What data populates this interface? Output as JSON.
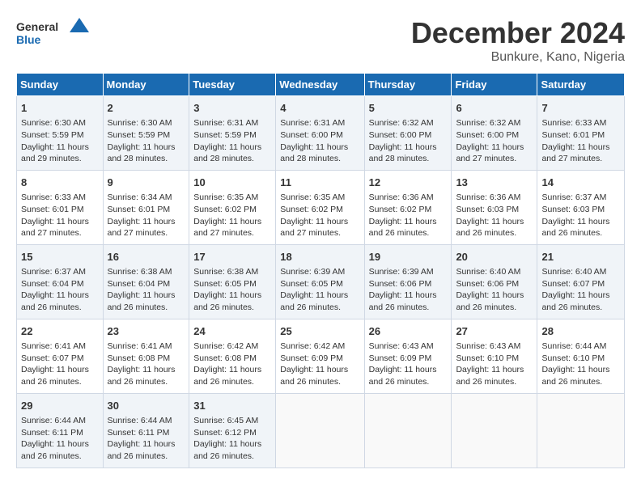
{
  "logo": {
    "text_general": "General",
    "text_blue": "Blue"
  },
  "title": {
    "month_year": "December 2024",
    "location": "Bunkure, Kano, Nigeria"
  },
  "days_of_week": [
    "Sunday",
    "Monday",
    "Tuesday",
    "Wednesday",
    "Thursday",
    "Friday",
    "Saturday"
  ],
  "weeks": [
    [
      {
        "day": "1",
        "sunrise": "6:30 AM",
        "sunset": "5:59 PM",
        "daylight": "11 hours and 29 minutes."
      },
      {
        "day": "2",
        "sunrise": "6:30 AM",
        "sunset": "5:59 PM",
        "daylight": "11 hours and 28 minutes."
      },
      {
        "day": "3",
        "sunrise": "6:31 AM",
        "sunset": "5:59 PM",
        "daylight": "11 hours and 28 minutes."
      },
      {
        "day": "4",
        "sunrise": "6:31 AM",
        "sunset": "6:00 PM",
        "daylight": "11 hours and 28 minutes."
      },
      {
        "day": "5",
        "sunrise": "6:32 AM",
        "sunset": "6:00 PM",
        "daylight": "11 hours and 28 minutes."
      },
      {
        "day": "6",
        "sunrise": "6:32 AM",
        "sunset": "6:00 PM",
        "daylight": "11 hours and 27 minutes."
      },
      {
        "day": "7",
        "sunrise": "6:33 AM",
        "sunset": "6:01 PM",
        "daylight": "11 hours and 27 minutes."
      }
    ],
    [
      {
        "day": "8",
        "sunrise": "6:33 AM",
        "sunset": "6:01 PM",
        "daylight": "11 hours and 27 minutes."
      },
      {
        "day": "9",
        "sunrise": "6:34 AM",
        "sunset": "6:01 PM",
        "daylight": "11 hours and 27 minutes."
      },
      {
        "day": "10",
        "sunrise": "6:35 AM",
        "sunset": "6:02 PM",
        "daylight": "11 hours and 27 minutes."
      },
      {
        "day": "11",
        "sunrise": "6:35 AM",
        "sunset": "6:02 PM",
        "daylight": "11 hours and 27 minutes."
      },
      {
        "day": "12",
        "sunrise": "6:36 AM",
        "sunset": "6:02 PM",
        "daylight": "11 hours and 26 minutes."
      },
      {
        "day": "13",
        "sunrise": "6:36 AM",
        "sunset": "6:03 PM",
        "daylight": "11 hours and 26 minutes."
      },
      {
        "day": "14",
        "sunrise": "6:37 AM",
        "sunset": "6:03 PM",
        "daylight": "11 hours and 26 minutes."
      }
    ],
    [
      {
        "day": "15",
        "sunrise": "6:37 AM",
        "sunset": "6:04 PM",
        "daylight": "11 hours and 26 minutes."
      },
      {
        "day": "16",
        "sunrise": "6:38 AM",
        "sunset": "6:04 PM",
        "daylight": "11 hours and 26 minutes."
      },
      {
        "day": "17",
        "sunrise": "6:38 AM",
        "sunset": "6:05 PM",
        "daylight": "11 hours and 26 minutes."
      },
      {
        "day": "18",
        "sunrise": "6:39 AM",
        "sunset": "6:05 PM",
        "daylight": "11 hours and 26 minutes."
      },
      {
        "day": "19",
        "sunrise": "6:39 AM",
        "sunset": "6:06 PM",
        "daylight": "11 hours and 26 minutes."
      },
      {
        "day": "20",
        "sunrise": "6:40 AM",
        "sunset": "6:06 PM",
        "daylight": "11 hours and 26 minutes."
      },
      {
        "day": "21",
        "sunrise": "6:40 AM",
        "sunset": "6:07 PM",
        "daylight": "11 hours and 26 minutes."
      }
    ],
    [
      {
        "day": "22",
        "sunrise": "6:41 AM",
        "sunset": "6:07 PM",
        "daylight": "11 hours and 26 minutes."
      },
      {
        "day": "23",
        "sunrise": "6:41 AM",
        "sunset": "6:08 PM",
        "daylight": "11 hours and 26 minutes."
      },
      {
        "day": "24",
        "sunrise": "6:42 AM",
        "sunset": "6:08 PM",
        "daylight": "11 hours and 26 minutes."
      },
      {
        "day": "25",
        "sunrise": "6:42 AM",
        "sunset": "6:09 PM",
        "daylight": "11 hours and 26 minutes."
      },
      {
        "day": "26",
        "sunrise": "6:43 AM",
        "sunset": "6:09 PM",
        "daylight": "11 hours and 26 minutes."
      },
      {
        "day": "27",
        "sunrise": "6:43 AM",
        "sunset": "6:10 PM",
        "daylight": "11 hours and 26 minutes."
      },
      {
        "day": "28",
        "sunrise": "6:44 AM",
        "sunset": "6:10 PM",
        "daylight": "11 hours and 26 minutes."
      }
    ],
    [
      {
        "day": "29",
        "sunrise": "6:44 AM",
        "sunset": "6:11 PM",
        "daylight": "11 hours and 26 minutes."
      },
      {
        "day": "30",
        "sunrise": "6:44 AM",
        "sunset": "6:11 PM",
        "daylight": "11 hours and 26 minutes."
      },
      {
        "day": "31",
        "sunrise": "6:45 AM",
        "sunset": "6:12 PM",
        "daylight": "11 hours and 26 minutes."
      },
      null,
      null,
      null,
      null
    ]
  ]
}
